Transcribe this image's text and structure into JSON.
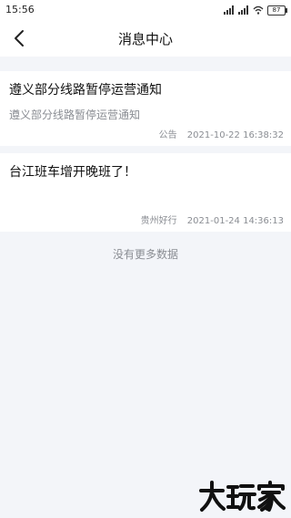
{
  "status_bar": {
    "time": "15:56",
    "battery": "87",
    "icons": [
      "signal-icon",
      "signal-icon",
      "wifi-icon",
      "battery-icon"
    ]
  },
  "header": {
    "title": "消息中心",
    "back_icon": "chevron-left-icon"
  },
  "messages": [
    {
      "title": "遵义部分线路暂停运营通知",
      "body": "遵义部分线路暂停运营通知",
      "source": "公告",
      "time": "2021-10-22 16:38:32"
    },
    {
      "title": "台江班车增开晚班了！",
      "body": "",
      "source": "贵州好行",
      "time": "2021-01-24 14:36:13"
    }
  ],
  "footer_note": "没有更多数据",
  "watermark": "大玩家",
  "colors": {
    "background": "#f3f5f9",
    "card": "#ffffff",
    "secondary_text": "#8a8d93"
  }
}
